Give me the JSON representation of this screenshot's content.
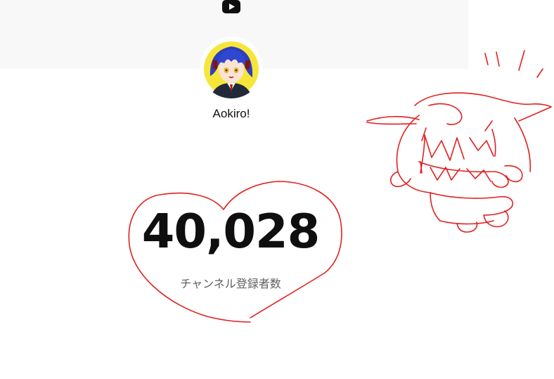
{
  "channel": {
    "name": "Aokiro!",
    "subscriber_count": "40,028",
    "subscriber_label": "チャンネル登録者数"
  },
  "icons": {
    "platform": "youtube-icon",
    "avatar": "anime-avatar"
  },
  "colors": {
    "header_band": "#f8f8f8",
    "youtube_logo": "#0f0f0f",
    "count_text": "#0f0f0f",
    "label_text": "#606060",
    "doodle_red": "#e0201f",
    "avatar_hair": "#2b3fbf",
    "avatar_bg": "#f7e63a"
  }
}
